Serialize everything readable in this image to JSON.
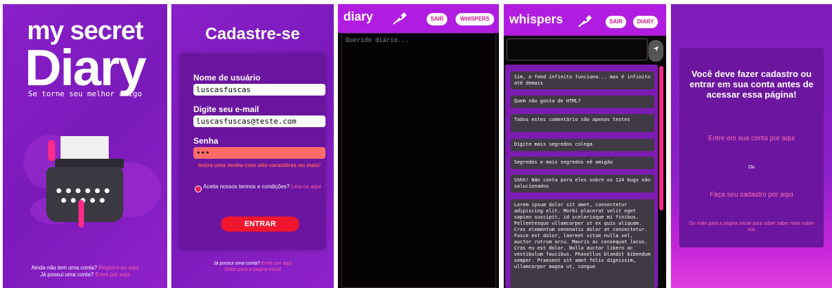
{
  "panel1": {
    "title_line1": "my secret",
    "title_line2": "Diary",
    "subtitle": "Se torne seu melhor amigo",
    "footer_line1_text": "Ainda não tem uma conta?",
    "footer_line1_link": "Registre-se aqui",
    "footer_line2_text": "Já possui uma conta?",
    "footer_line2_link": "Entre por aqui"
  },
  "panel2": {
    "title": "Cadastre-se",
    "username_label": "Nome de usuário",
    "username_value": "luscasfuscas",
    "email_label": "Digite seu e-mail",
    "email_value": "luscasfuscas@teste.com",
    "password_label": "Senha",
    "password_value": "•••",
    "password_error": "Insira uma senha com oito caractéres ou mais!",
    "terms_text": "Aceita nossos termos e condições?",
    "terms_link": "Leia-os aqui",
    "submit_label": "ENTRAR",
    "footer_line1_text": "Já possui uma conta?",
    "footer_line1_link": "Entre por aqui",
    "footer_line2_link": "Voltar para a página inicial"
  },
  "panel3": {
    "title": "diary",
    "logout_label": "SAIR",
    "whispers_label": "WHISPERS",
    "placeholder": "Querido diário..."
  },
  "panel4": {
    "title": "whispers",
    "logout_label": "SAIR",
    "diary_label": "DIARY",
    "messages": [
      "Sim, o feed infinito funciona... mas é infinito até demais",
      "Quem não gosta de HTML?",
      "Todos estes comentário são apenas testes",
      "Digite mais segredos colega",
      "Segredos e mais segredos né amigão",
      "Shhh! Não conta para eles sobre os 124 bugs não solucionados",
      "Lorem ipsum dolor sit amet, consectetur adipiscing elit. Morbi placerat velit eget sapien suscipit, id scelerisque mi finibus. Pellentesque ullamcorper ut ex quis aliquam. Cras elementum venenatis dolor at consectetur. Fusce est dolor, laoreet vitae nulla vel, auctor rutrum arcu. Mauris ac consequat lacus. Cras eu est dolor. Nulla auctor libero ac vestibulum faucibus. Phasellus blandit bibendum semper. Praesent sit amet felis dignissim, ullamcorper magna ut, congue"
    ]
  },
  "panel5": {
    "message": "Você deve fazer cadastro ou entrar em sua conta antes de acessar essa página!",
    "login_link": "Entre em sua conta por aqui",
    "or_text": "Ou",
    "register_link": "Faça seu cadastro por aqui",
    "back_link": "Ou volte para a página inicial para saber saber mais sobre nós"
  },
  "colors": {
    "purple": "#8a1fc9",
    "magenta_bar": "#b01de0",
    "pink": "#ff5fa8",
    "red_button": "#f0162e"
  },
  "icons": [
    "pen-nib-icon",
    "send-arrow-icon",
    "typewriter-illustration"
  ]
}
